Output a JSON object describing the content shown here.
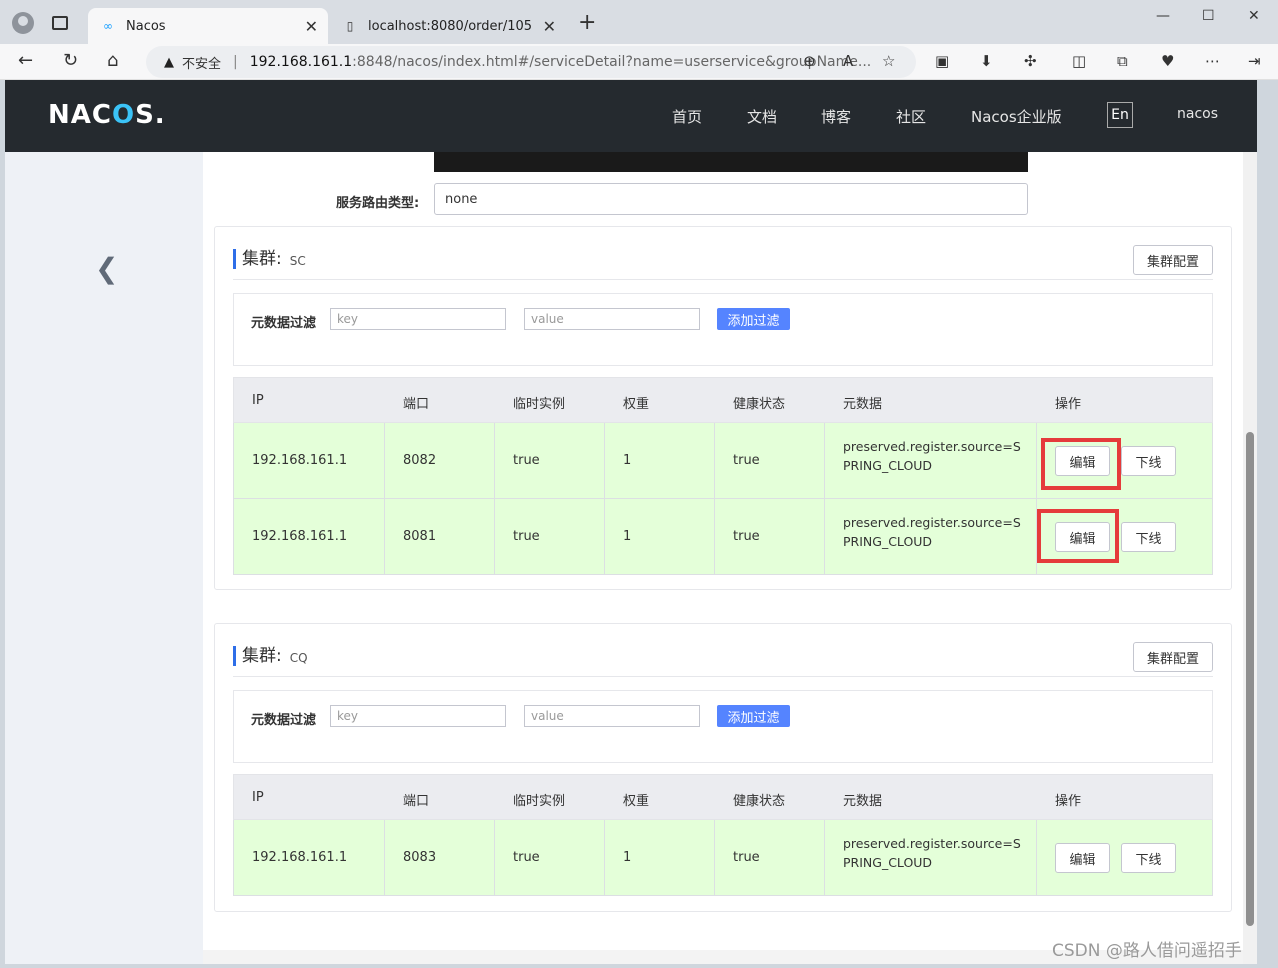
{
  "browser": {
    "tabs": [
      {
        "title": "Nacos",
        "active": true
      },
      {
        "title": "localhost:8080/order/105",
        "active": false
      }
    ],
    "address": {
      "security_label": "不安全",
      "host": "192.168.161.1",
      "rest": ":8848/nacos/index.html#/serviceDetail?name=userservice&groupName..."
    }
  },
  "header": {
    "logo": "NACOS.",
    "nav": [
      "首页",
      "文档",
      "博客",
      "社区",
      "Nacos企业版"
    ],
    "lang": "En",
    "user": "nacos"
  },
  "form": {
    "route_type_label": "服务路由类型:",
    "route_type_value": "none"
  },
  "table_columns": [
    "IP",
    "端口",
    "临时实例",
    "权重",
    "健康状态",
    "元数据",
    "操作"
  ],
  "clusters": [
    {
      "title": "集群:",
      "name": "SC",
      "config_button": "集群配置",
      "filter": {
        "label": "元数据过滤",
        "key_placeholder": "key",
        "value_placeholder": "value",
        "add_button": "添加过滤"
      },
      "rows": [
        {
          "ip": "192.168.161.1",
          "port": "8082",
          "ephemeral": "true",
          "weight": "1",
          "healthy": "true",
          "meta": "preserved.register.source=SPRING_CLOUD",
          "edit": "编辑",
          "offline": "下线"
        },
        {
          "ip": "192.168.161.1",
          "port": "8081",
          "ephemeral": "true",
          "weight": "1",
          "healthy": "true",
          "meta": "preserved.register.source=SPRING_CLOUD",
          "edit": "编辑",
          "offline": "下线"
        }
      ]
    },
    {
      "title": "集群:",
      "name": "CQ",
      "config_button": "集群配置",
      "filter": {
        "label": "元数据过滤",
        "key_placeholder": "key",
        "value_placeholder": "value",
        "add_button": "添加过滤"
      },
      "rows": [
        {
          "ip": "192.168.161.1",
          "port": "8083",
          "ephemeral": "true",
          "weight": "1",
          "healthy": "true",
          "meta": "preserved.register.source=SPRING_CLOUD",
          "edit": "编辑",
          "offline": "下线"
        }
      ]
    }
  ],
  "watermark": "CSDN @路人借问遥招手"
}
